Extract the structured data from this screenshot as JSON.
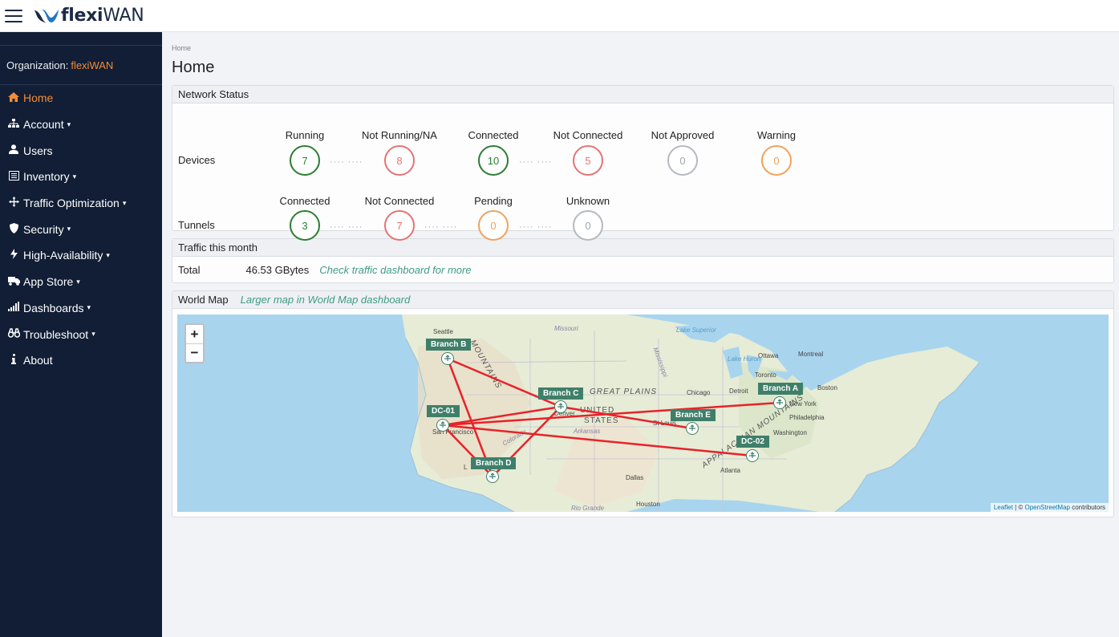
{
  "brand": {
    "name_bold": "flexi",
    "name_rest": "WAN"
  },
  "sidebar": {
    "org_label": "Organization:",
    "org_name": "flexiWAN",
    "items": [
      {
        "label": "Home",
        "icon": "home-icon",
        "caret": ""
      },
      {
        "label": "Account",
        "icon": "sitemap-icon",
        "caret": "▾"
      },
      {
        "label": "Users",
        "icon": "user-icon",
        "caret": ""
      },
      {
        "label": "Inventory",
        "icon": "list-icon",
        "caret": "▾"
      },
      {
        "label": "Traffic Optimization",
        "icon": "arrows-icon",
        "caret": "▾"
      },
      {
        "label": "Security",
        "icon": "shield-icon",
        "caret": "▾"
      },
      {
        "label": "High-Availability",
        "icon": "bolt-icon",
        "caret": "▾"
      },
      {
        "label": "App Store",
        "icon": "truck-icon",
        "caret": "▾"
      },
      {
        "label": "Dashboards",
        "icon": "signal-icon",
        "caret": "▾"
      },
      {
        "label": "Troubleshoot",
        "icon": "binoculars-icon",
        "caret": "▾"
      },
      {
        "label": "About",
        "icon": "info-icon",
        "caret": ""
      }
    ]
  },
  "breadcrumb": "Home",
  "page_title": "Home",
  "network_status": {
    "title": "Network Status",
    "devices_label": "Devices",
    "tunnels_label": "Tunnels",
    "devices": [
      {
        "label": "Running",
        "value": "7"
      },
      {
        "label": "Not Running/NA",
        "value": "8"
      },
      {
        "label": "Connected",
        "value": "10"
      },
      {
        "label": "Not Connected",
        "value": "5"
      },
      {
        "label": "Not Approved",
        "value": "0"
      },
      {
        "label": "Warning",
        "value": "0"
      }
    ],
    "tunnels": [
      {
        "label": "Connected",
        "value": "3"
      },
      {
        "label": "Not Connected",
        "value": "7"
      },
      {
        "label": "Pending",
        "value": "0"
      },
      {
        "label": "Unknown",
        "value": "0"
      }
    ],
    "dots": "···· ····"
  },
  "traffic": {
    "title": "Traffic this month",
    "total_label": "Total",
    "total_value": "46.53 GBytes",
    "link": "Check traffic dashboard for more"
  },
  "world_map": {
    "title": "World Map",
    "link": "Larger map in World Map dashboard",
    "zoom_in": "+",
    "zoom_out": "−",
    "attribution_leaflet": "Leaflet",
    "attribution_sep": " | © ",
    "attribution_osm": "OpenStreetMap",
    "attribution_rest": " contributors",
    "sites": [
      "Branch A",
      "Branch B",
      "Branch C",
      "Branch D",
      "Branch E",
      "DC-01",
      "DC-02"
    ],
    "places": [
      "Seattle",
      "Missouri",
      "Lake Superior",
      "Ottawa",
      "Montreal",
      "Toronto",
      "Lake Huron",
      "Boston",
      "New York",
      "Philadelphia",
      "Washington",
      "Chicago",
      "Detroit",
      "GREAT PLAINS",
      "UNITED",
      "STATES",
      "St Louis",
      "Denver",
      "San Francisco",
      "Atlanta",
      "Dallas",
      "Houston",
      "Arkansas",
      "Colorado",
      "Mississippi",
      "MOUNTAINS",
      "APPALACHIAN MOUNTAINS",
      "Rio Grande",
      "L"
    ],
    "link_color": "#e8222a",
    "tag_color": "#3f7f6a"
  }
}
